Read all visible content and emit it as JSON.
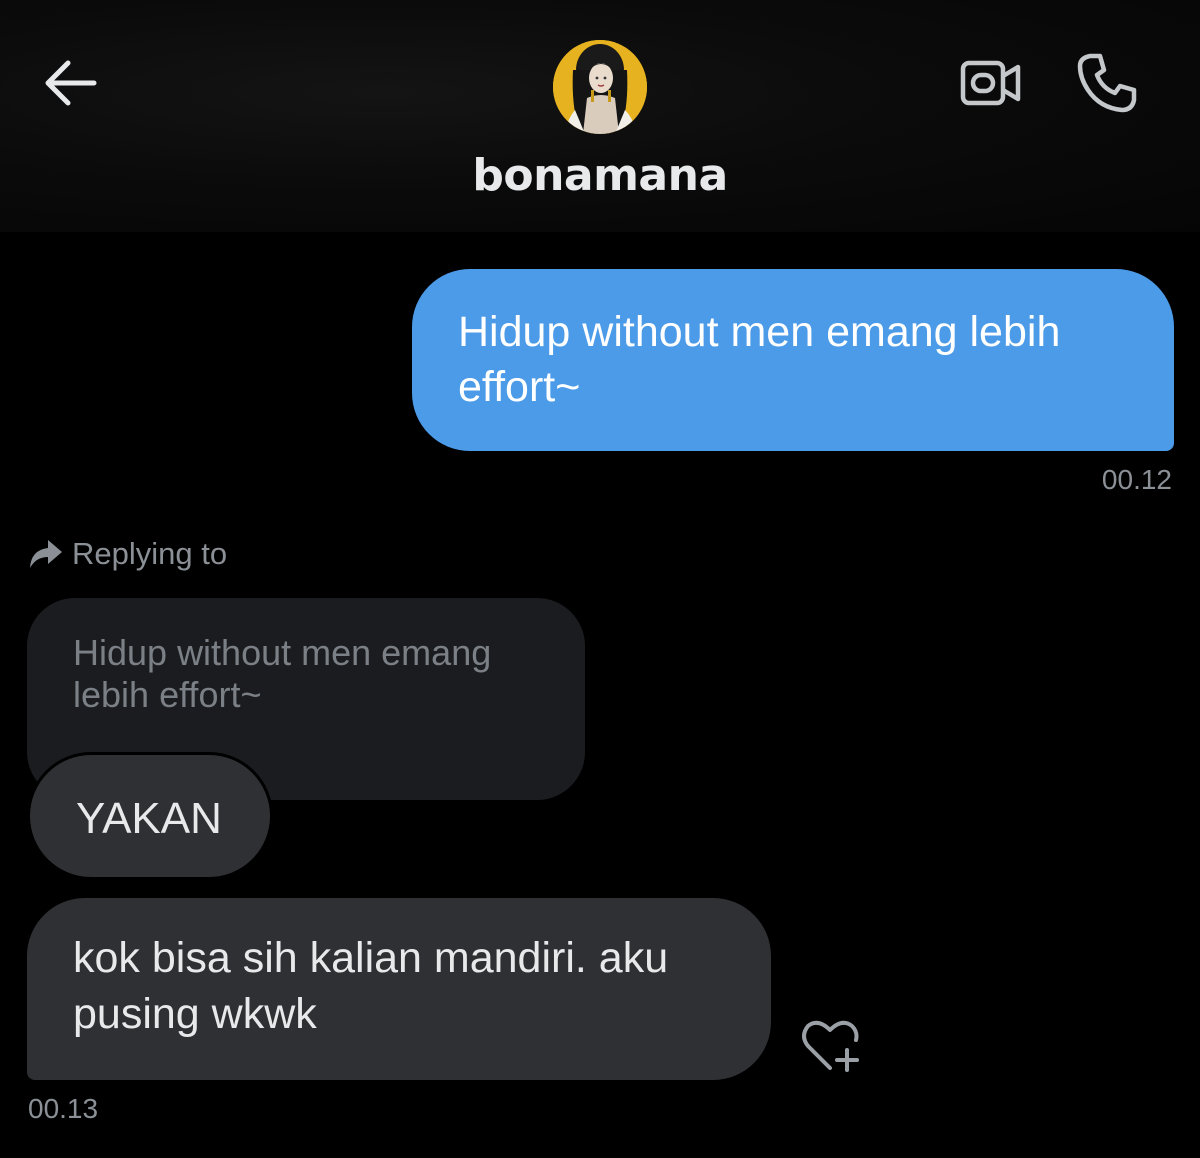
{
  "header": {
    "username": "bonamana",
    "icons": {
      "back": "arrow-left-icon",
      "video": "video-camera-icon",
      "call": "phone-icon",
      "avatar": "profile-avatar"
    }
  },
  "messages": {
    "sent": {
      "text": "Hidup without men emang lebih effort~",
      "time": "00.12"
    },
    "reply": {
      "label": "Replying to",
      "quoted_text": "Hidup without men emang lebih effort~",
      "icon": "reply-arrow-icon"
    },
    "received": [
      {
        "text": "YAKAN"
      },
      {
        "text": "kok bisa sih kalian mandiri. aku pusing wkwk"
      }
    ],
    "received_time": "00.13",
    "react_icon": "heart-plus-icon"
  },
  "colors": {
    "sent_bubble": "#4c9be8",
    "received_bubble": "#2f3033",
    "quoted_bubble": "#1b1c1f",
    "background": "#000000",
    "muted_text": "#8b9096",
    "avatar_bg": "#e6b21f"
  }
}
